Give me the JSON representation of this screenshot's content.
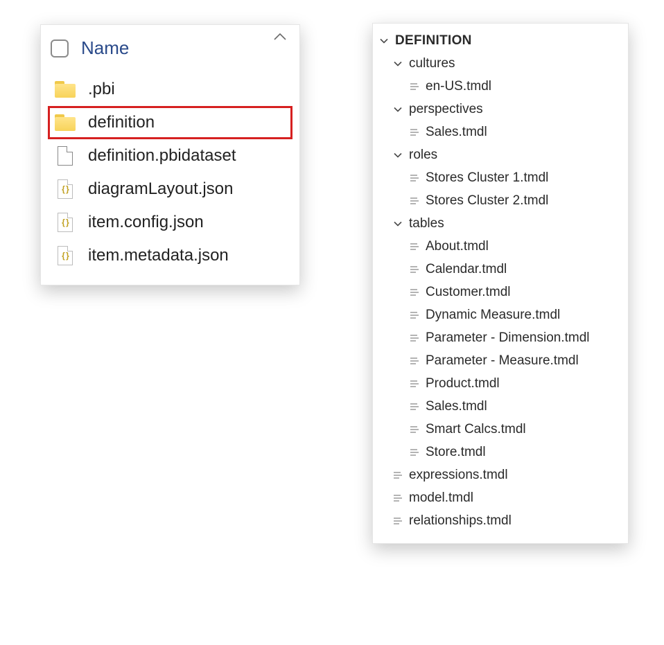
{
  "left": {
    "column_header": "Name",
    "items": [
      {
        "name": ".pbi",
        "type": "folder",
        "highlighted": false
      },
      {
        "name": "definition",
        "type": "folder",
        "highlighted": true
      },
      {
        "name": "definition.pbidataset",
        "type": "file",
        "highlighted": false
      },
      {
        "name": "diagramLayout.json",
        "type": "json",
        "highlighted": false
      },
      {
        "name": "item.config.json",
        "type": "json",
        "highlighted": false
      },
      {
        "name": "item.metadata.json",
        "type": "json",
        "highlighted": false
      }
    ]
  },
  "right": {
    "root_label": "DEFINITION",
    "groups": [
      {
        "label": "cultures",
        "files": [
          "en-US.tmdl"
        ]
      },
      {
        "label": "perspectives",
        "files": [
          "Sales.tmdl"
        ]
      },
      {
        "label": "roles",
        "files": [
          "Stores Cluster 1.tmdl",
          "Stores Cluster 2.tmdl"
        ]
      },
      {
        "label": "tables",
        "files": [
          "About.tmdl",
          "Calendar.tmdl",
          "Customer.tmdl",
          "Dynamic Measure.tmdl",
          "Parameter - Dimension.tmdl",
          "Parameter - Measure.tmdl",
          "Product.tmdl",
          "Sales.tmdl",
          "Smart Calcs.tmdl",
          "Store.tmdl"
        ]
      }
    ],
    "root_files": [
      "expressions.tmdl",
      "model.tmdl",
      "relationships.tmdl"
    ]
  }
}
